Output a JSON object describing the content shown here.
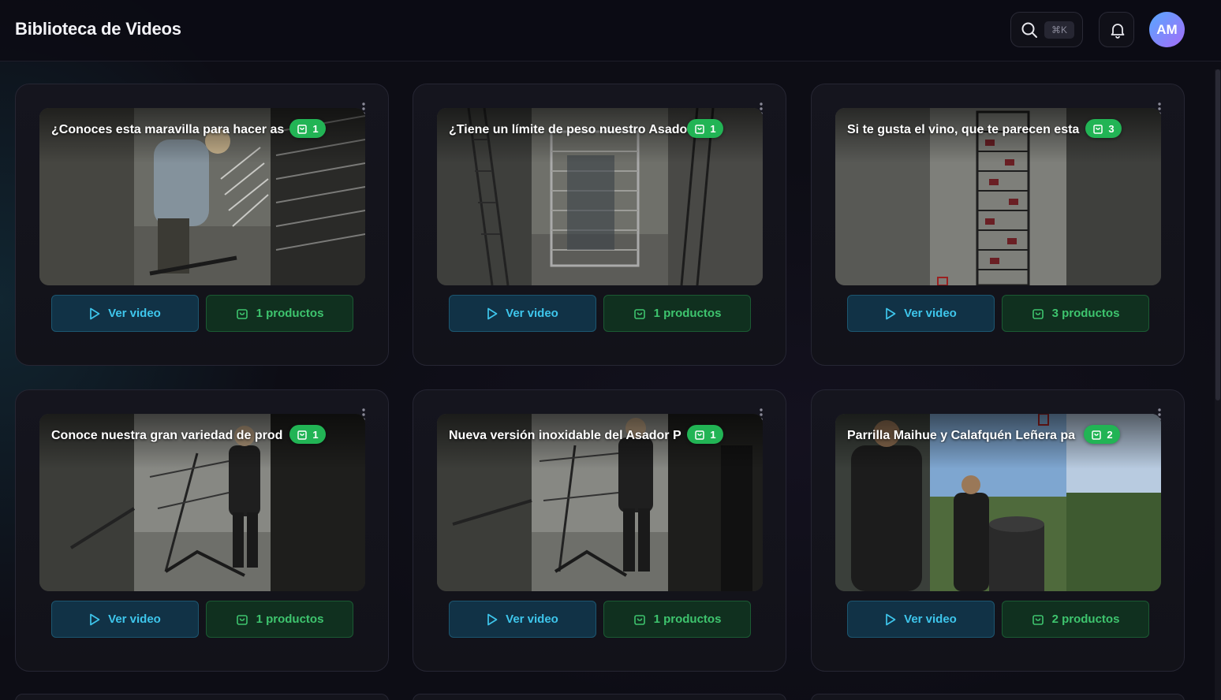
{
  "header": {
    "title": "Biblioteca de Videos",
    "search_shortcut": "⌘K",
    "avatar_initials": "AM"
  },
  "videos": [
    {
      "title": "¿Conoces esta maravilla para hacer as",
      "badge": "1",
      "play_label": "Ver video",
      "products_label": "1 productos"
    },
    {
      "title": "¿Tiene un límite de peso nuestro Asado",
      "badge": "1",
      "play_label": "Ver video",
      "products_label": "1 productos"
    },
    {
      "title": "Si te gusta el vino, que te parecen esta",
      "badge": "3",
      "play_label": "Ver video",
      "products_label": "3 productos"
    },
    {
      "title": "Conoce nuestra gran variedad de prod",
      "badge": "1",
      "play_label": "Ver video",
      "products_label": "1 productos"
    },
    {
      "title": "Nueva versión inoxidable del Asador P",
      "badge": "1",
      "play_label": "Ver video",
      "products_label": "1 productos"
    },
    {
      "title": "Parrilla Maihue y Calafquén Leñera pa",
      "badge": "2",
      "play_label": "Ver video",
      "products_label": "2 productos"
    }
  ],
  "colors": {
    "badge": "#22b455",
    "play_text": "#3ec6ec",
    "products_text": "#3ec46e"
  }
}
